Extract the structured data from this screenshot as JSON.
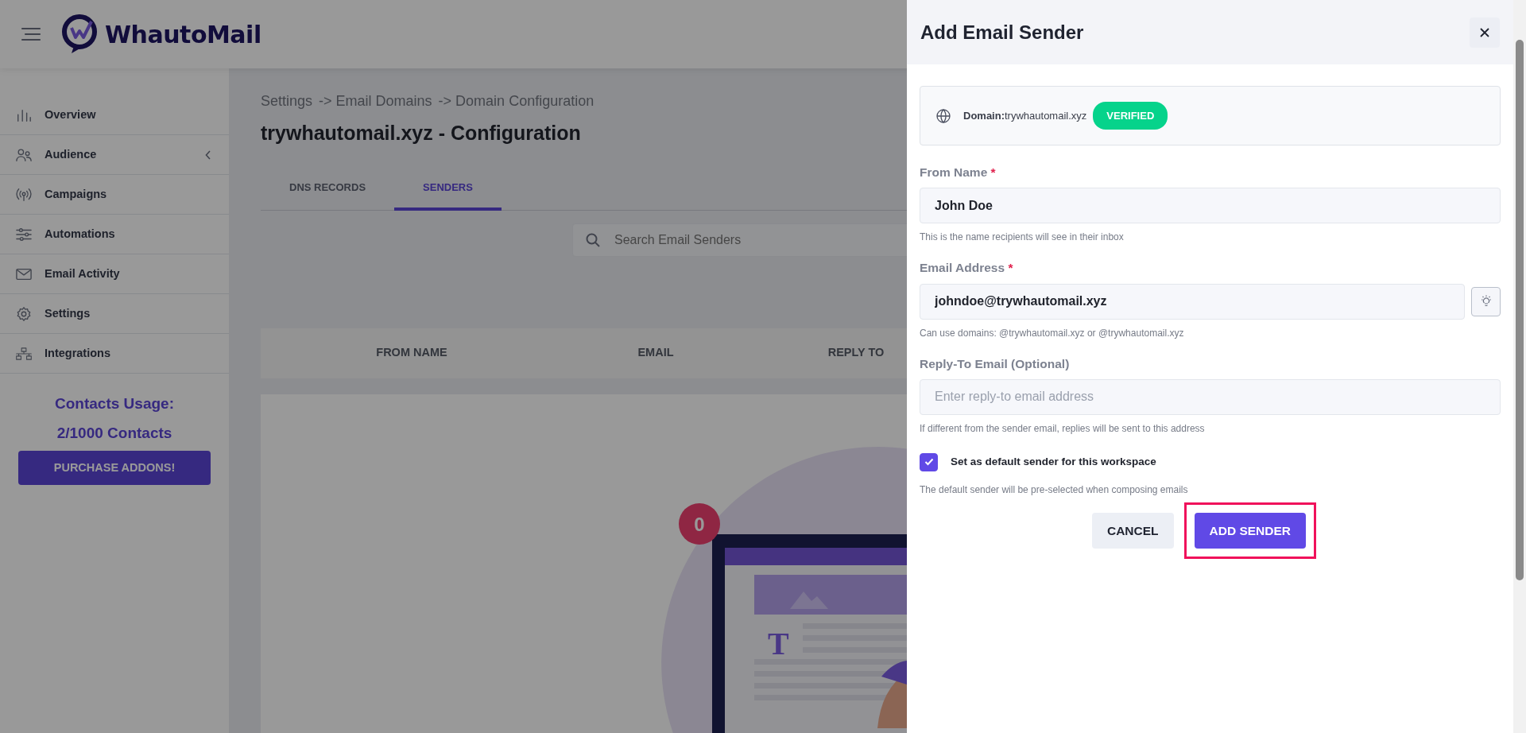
{
  "header": {
    "brand": "WhautoMail"
  },
  "sidebar": {
    "items": [
      {
        "label": "Overview",
        "submenu": false
      },
      {
        "label": "Audience",
        "submenu": true
      },
      {
        "label": "Campaigns",
        "submenu": false
      },
      {
        "label": "Automations",
        "submenu": false
      },
      {
        "label": "Email Activity",
        "submenu": false
      },
      {
        "label": "Settings",
        "submenu": false
      },
      {
        "label": "Integrations",
        "submenu": false
      }
    ],
    "usage_title": "Contacts Usage:",
    "usage_value": "2/1000 Contacts",
    "purchase_button": "PURCHASE ADDONS!"
  },
  "breadcrumb": [
    "Settings",
    "-> Email Domains",
    "-> Domain Configuration"
  ],
  "page_title": "trywhautomail.xyz - Configuration",
  "tabs": [
    {
      "label": "DNS RECORDS",
      "selected": false
    },
    {
      "label": "SENDERS",
      "selected": true
    }
  ],
  "search": {
    "placeholder": "Search Email Senders"
  },
  "table": {
    "columns": [
      "FROM NAME",
      "EMAIL",
      "REPLY TO"
    ]
  },
  "empty_state": {
    "badge": "0",
    "letter": "T"
  },
  "panel": {
    "title": "Add Email Sender",
    "domain": {
      "text": "**Domain:**trywhautomail.xyz",
      "status": "VERIFIED"
    },
    "fields": [
      {
        "kind": "text",
        "label": "From Name",
        "required_mark": "*",
        "value": "John Doe",
        "help": "This is the name recipients will see in their inbox"
      },
      {
        "kind": "suggest",
        "label": "Email Address",
        "required_mark": "*",
        "value": "johndoe@trywhautomail.xyz",
        "help": "Can use domains: @trywhautomail.xyz or @trywhautomail.xyz"
      },
      {
        "kind": "text",
        "label": "Reply-To Email (Optional)",
        "placeholder": "Enter reply-to email address",
        "help": "If different from the sender email, replies will be sent to this address"
      }
    ],
    "default_sender": {
      "label": "Set as default sender for this workspace",
      "checked": true,
      "help": "The default sender will be pre-selected when composing emails"
    },
    "buttons": [
      {
        "label": "CANCEL",
        "kind": "secondary",
        "highlighted": false
      },
      {
        "label": "ADD SENDER",
        "kind": "primary",
        "highlighted": true
      }
    ]
  }
}
